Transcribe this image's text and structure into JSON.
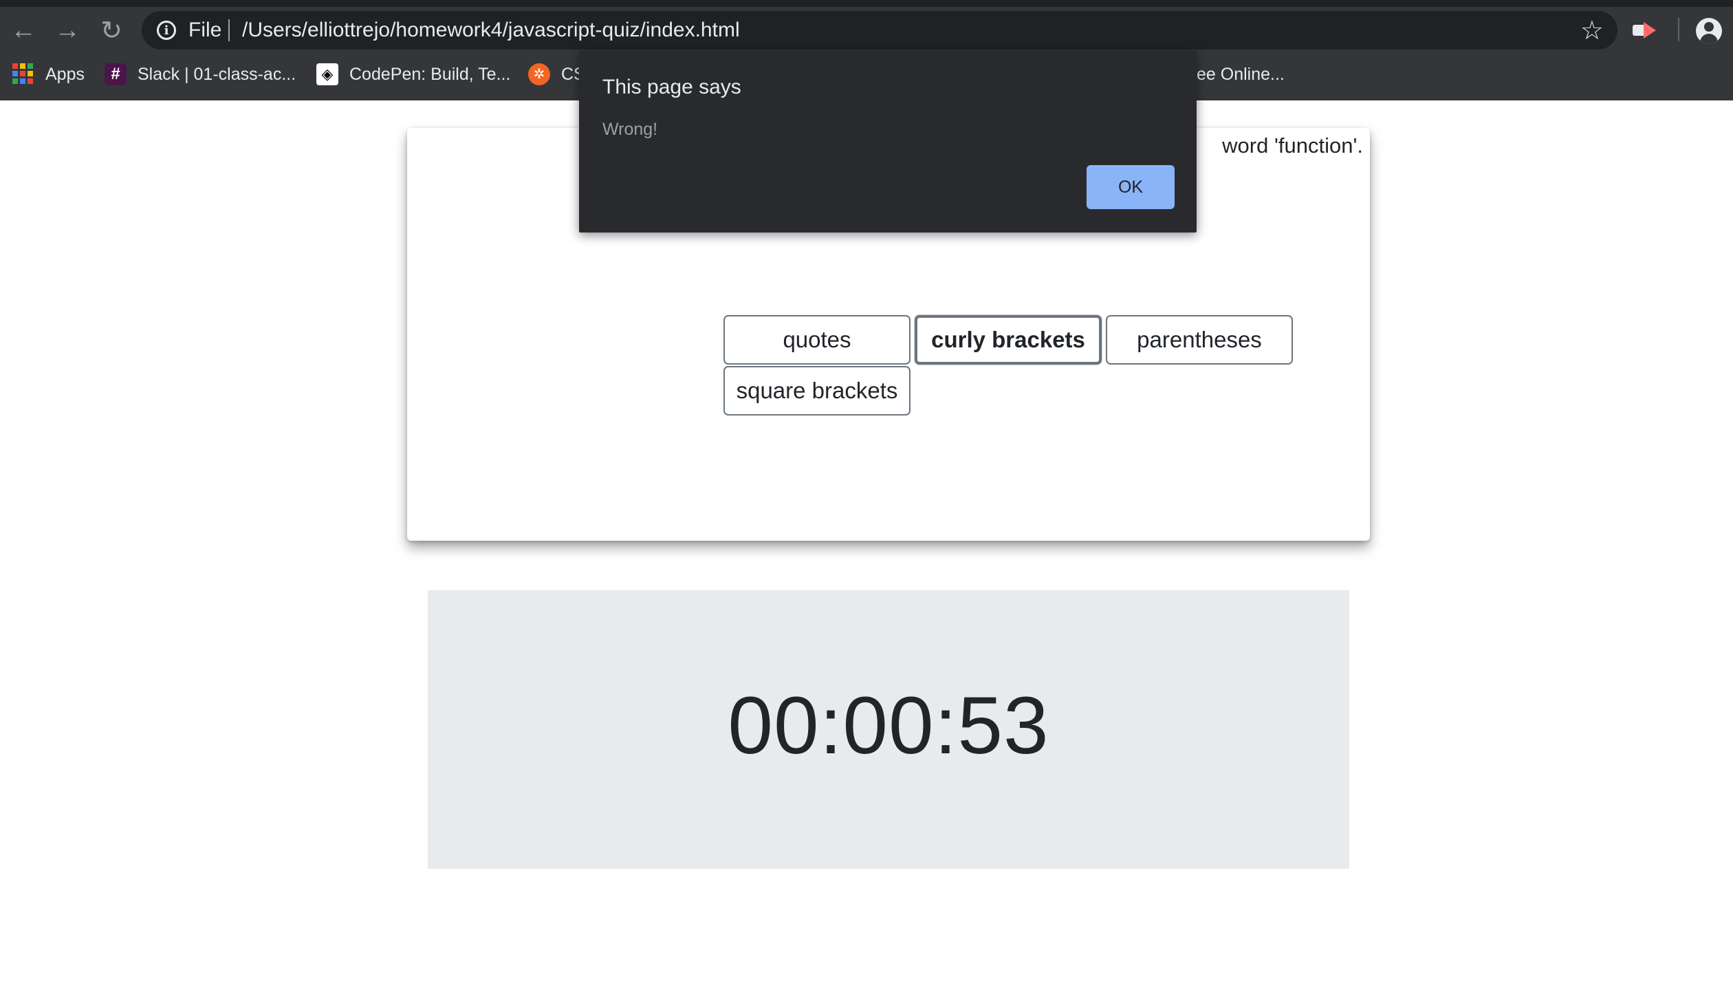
{
  "browser": {
    "scheme_label": "File",
    "url": "/Users/elliottrejo/homework4/javascript-quiz/index.html",
    "bookmarks": [
      {
        "label": "Apps"
      },
      {
        "label": "Slack | 01-class-ac..."
      },
      {
        "label": "CodePen: Build, Te..."
      },
      {
        "label": "CS"
      },
      {
        "label": "ee Online..."
      }
    ]
  },
  "quiz": {
    "question_visible": "word 'function'.",
    "answers": [
      "quotes",
      "curly brackets",
      "parentheses",
      "square brackets"
    ],
    "focused_answer": "curly brackets"
  },
  "timer": {
    "value": "00:00:53"
  },
  "dialog": {
    "title": "This page says",
    "message": "Wrong!",
    "ok_label": "OK"
  },
  "colors": {
    "chrome_bg": "#35363a",
    "dialog_bg": "#292a2d",
    "ok_button": "#8ab4f8",
    "timer_bg": "#e8ebee"
  }
}
